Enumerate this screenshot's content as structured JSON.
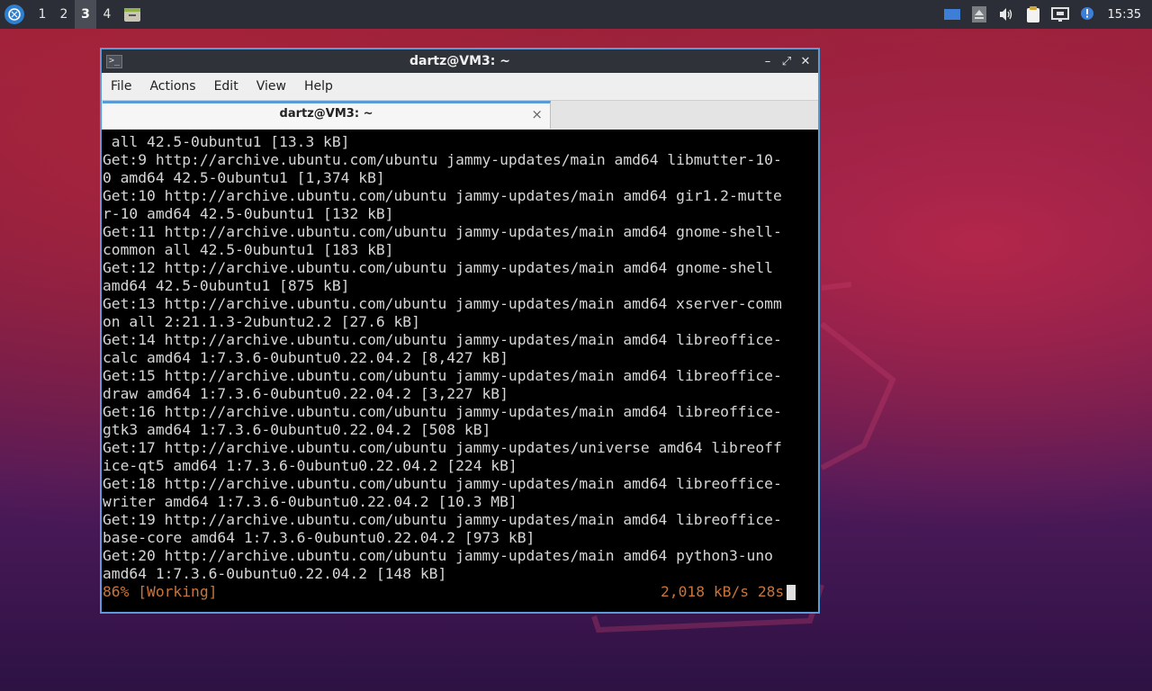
{
  "panel": {
    "workspaces": [
      "1",
      "2",
      "3",
      "4"
    ],
    "active_workspace": "3",
    "clock": "15:35",
    "icons": [
      "whisker-menu-icon",
      "file-manager-icon",
      "display-icon",
      "eject-icon",
      "volume-icon",
      "clipboard-icon",
      "network-icon",
      "notification-icon"
    ]
  },
  "window": {
    "title": "dartz@VM3: ~",
    "menu": [
      "File",
      "Actions",
      "Edit",
      "View",
      "Help"
    ],
    "tab_label": "dartz@VM3: ~",
    "tab_close": "×",
    "controls": {
      "minimize": "–",
      "maximize": "⤢",
      "close": "✕"
    }
  },
  "terminal": {
    "lines": [
      " all 42.5-0ubuntu1 [13.3 kB]",
      "Get:9 http://archive.ubuntu.com/ubuntu jammy-updates/main amd64 libmutter-10-",
      "0 amd64 42.5-0ubuntu1 [1,374 kB]",
      "Get:10 http://archive.ubuntu.com/ubuntu jammy-updates/main amd64 gir1.2-mutte",
      "r-10 amd64 42.5-0ubuntu1 [132 kB]",
      "Get:11 http://archive.ubuntu.com/ubuntu jammy-updates/main amd64 gnome-shell-",
      "common all 42.5-0ubuntu1 [183 kB]",
      "Get:12 http://archive.ubuntu.com/ubuntu jammy-updates/main amd64 gnome-shell",
      "amd64 42.5-0ubuntu1 [875 kB]",
      "Get:13 http://archive.ubuntu.com/ubuntu jammy-updates/main amd64 xserver-comm",
      "on all 2:21.1.3-2ubuntu2.2 [27.6 kB]",
      "Get:14 http://archive.ubuntu.com/ubuntu jammy-updates/main amd64 libreoffice-",
      "calc amd64 1:7.3.6-0ubuntu0.22.04.2 [8,427 kB]",
      "Get:15 http://archive.ubuntu.com/ubuntu jammy-updates/main amd64 libreoffice-",
      "draw amd64 1:7.3.6-0ubuntu0.22.04.2 [3,227 kB]",
      "Get:16 http://archive.ubuntu.com/ubuntu jammy-updates/main amd64 libreoffice-",
      "gtk3 amd64 1:7.3.6-0ubuntu0.22.04.2 [508 kB]",
      "Get:17 http://archive.ubuntu.com/ubuntu jammy-updates/universe amd64 libreoff",
      "ice-qt5 amd64 1:7.3.6-0ubuntu0.22.04.2 [224 kB]",
      "Get:18 http://archive.ubuntu.com/ubuntu jammy-updates/main amd64 libreoffice-",
      "writer amd64 1:7.3.6-0ubuntu0.22.04.2 [10.3 MB]",
      "Get:19 http://archive.ubuntu.com/ubuntu jammy-updates/main amd64 libreoffice-",
      "base-core amd64 1:7.3.6-0ubuntu0.22.04.2 [973 kB]",
      "Get:20 http://archive.ubuntu.com/ubuntu jammy-updates/main amd64 python3-uno",
      "amd64 1:7.3.6-0ubuntu0.22.04.2 [148 kB]"
    ],
    "status_left": "86% [Working]",
    "status_right": "2,018 kB/s 28s",
    "status_color": "#c8743c"
  }
}
